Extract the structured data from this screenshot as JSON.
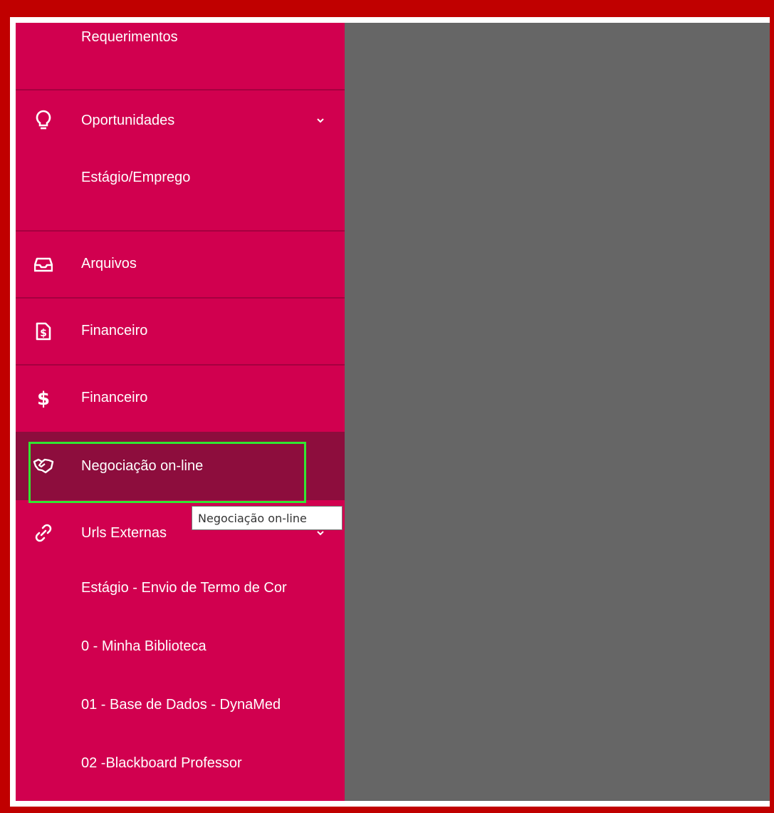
{
  "sidebar": {
    "top_item": "Requerimentos",
    "oportunidades": {
      "label": "Oportunidades",
      "sub": "Estágio/Emprego"
    },
    "arquivos": "Arquivos",
    "financeiro_1": "Financeiro",
    "financeiro_2": "Financeiro",
    "negociacao": "Negociação on-line",
    "urls": {
      "label": "Urls Externas",
      "items": [
        "Estágio - Envio de Termo de Cor",
        "0 - Minha Biblioteca",
        "01 - Base de Dados - DynaMed",
        "02 -Blackboard Professor"
      ]
    }
  },
  "tooltip": "Negociação on-line",
  "colors": {
    "sidebar_bg": "#d1004f",
    "active_bg": "#8d0d3d",
    "highlight": "#32e632",
    "overlay": "#666666",
    "frame": "#c00000"
  },
  "icons": {
    "oportunidades": "lightbulb-icon",
    "arquivos": "inbox-icon",
    "financeiro_1": "invoice-dollar-icon",
    "financeiro_2": "dollar-icon",
    "negociacao": "handshake-icon",
    "urls": "link-icon"
  }
}
